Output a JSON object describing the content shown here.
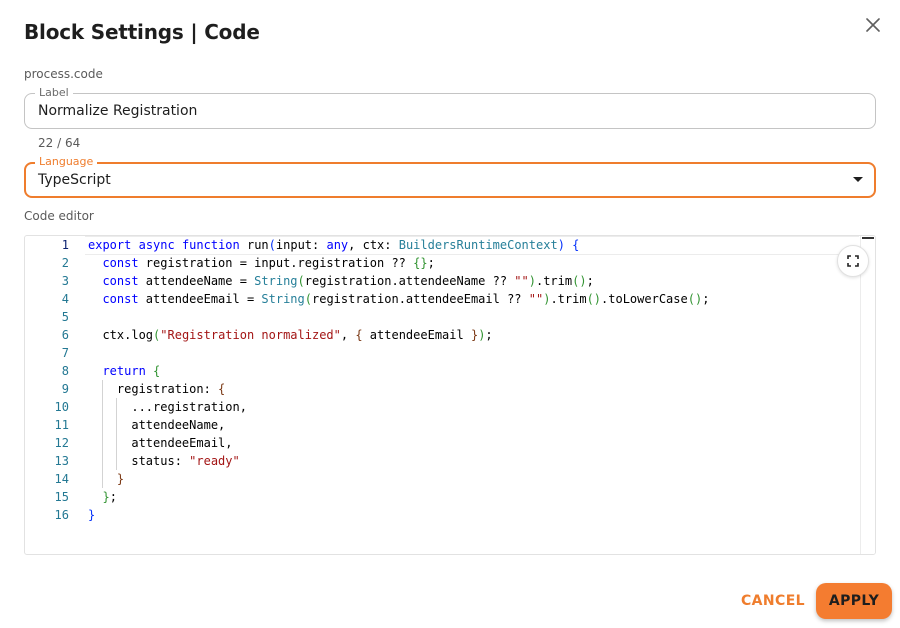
{
  "dialog": {
    "title": "Block Settings | Code",
    "block_id": "process.code",
    "close_icon": "close-icon"
  },
  "label_field": {
    "label": "Label",
    "value": "Normalize Registration",
    "counter": "22 / 64"
  },
  "language_field": {
    "label": "Language",
    "value": "TypeScript",
    "accent_color": "#ef7d2d"
  },
  "editor": {
    "caption": "Code editor",
    "fullscreen_icon": "fullscreen-icon",
    "line_numbers": [
      "1",
      "2",
      "3",
      "4",
      "5",
      "6",
      "7",
      "8",
      "9",
      "10",
      "11",
      "12",
      "13",
      "14",
      "15",
      "16"
    ],
    "lines": [
      "export async function run(input: any, ctx: BuildersRuntimeContext) {",
      "  const registration = input.registration ?? {};",
      "  const attendeeName = String(registration.attendeeName ?? \"\").trim();",
      "  const attendeeEmail = String(registration.attendeeEmail ?? \"\").trim().toLowerCase();",
      "",
      "  ctx.log(\"Registration normalized\", { attendeeEmail });",
      "",
      "  return {",
      "    registration: {",
      "      ...registration,",
      "      attendeeName,",
      "      attendeeEmail,",
      "      status: \"ready\"",
      "    }",
      "  };",
      "}"
    ]
  },
  "footer": {
    "cancel_label": "CANCEL",
    "apply_label": "APPLY",
    "apply_color": "#f47c30"
  }
}
